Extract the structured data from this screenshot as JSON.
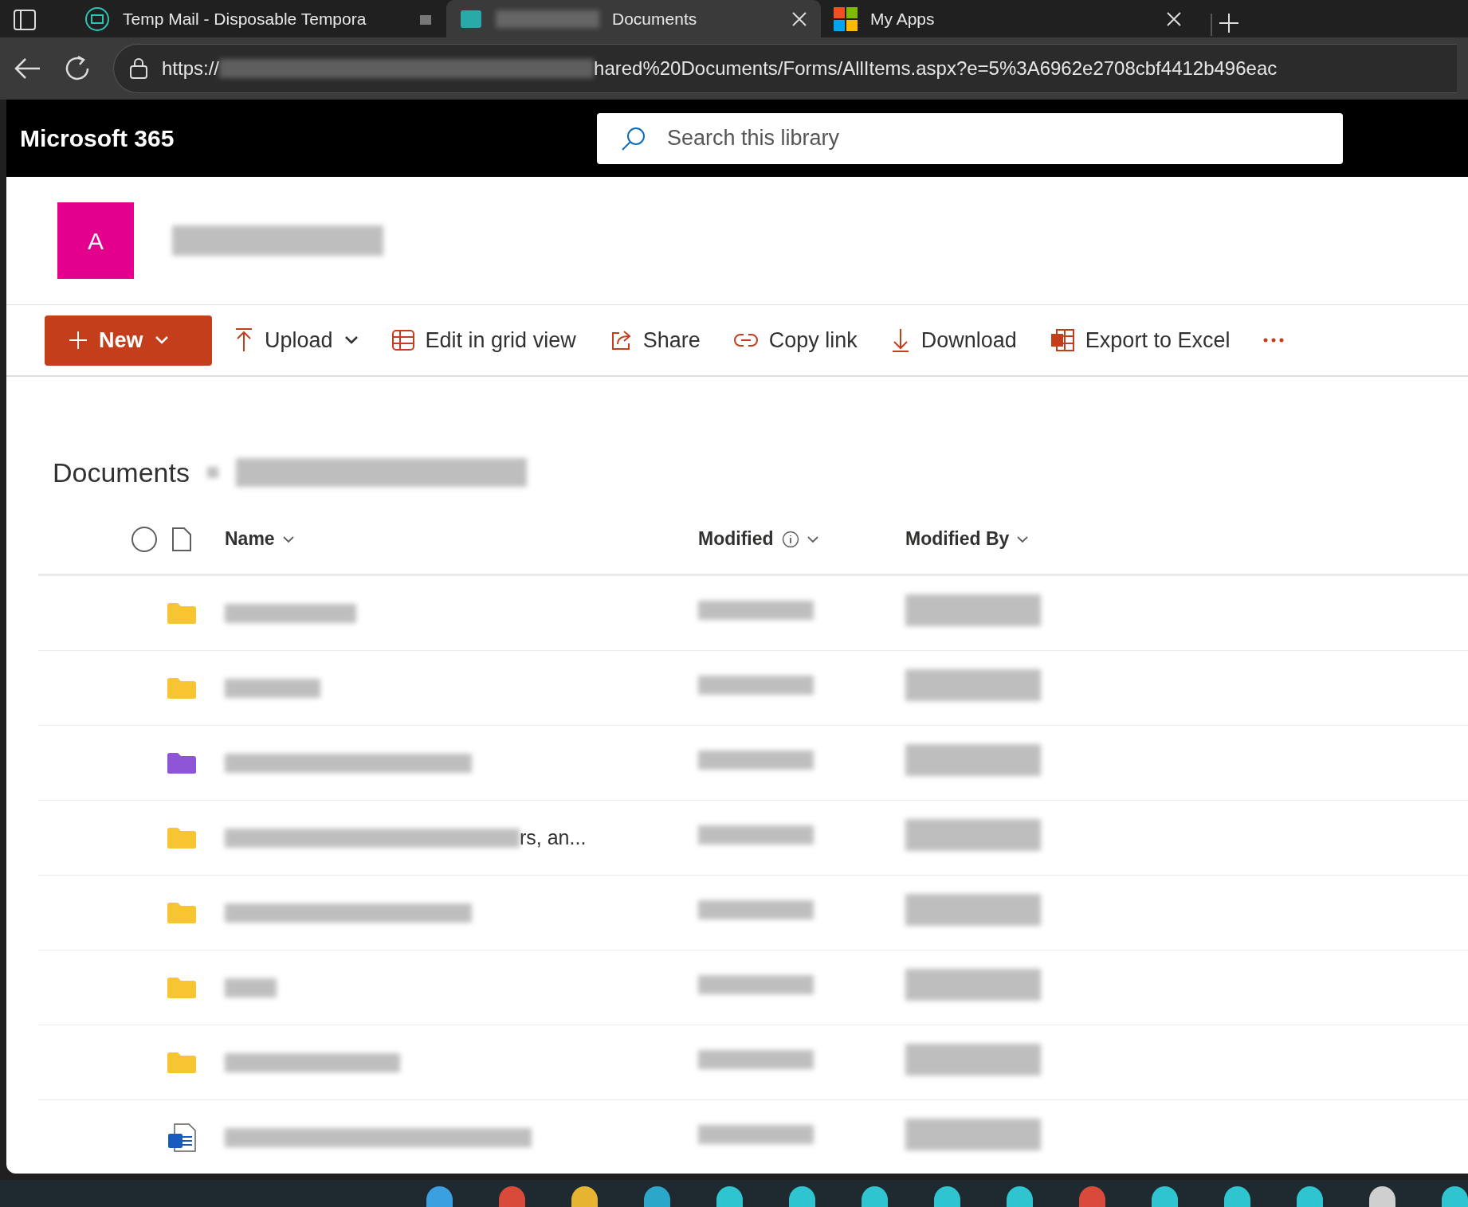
{
  "browser": {
    "tabs": [
      {
        "title": "Temp Mail - Disposable Tempora",
        "selected": false,
        "kind": "mail"
      },
      {
        "title": "Documents",
        "selected": true,
        "kind": "site"
      },
      {
        "title": "My Apps",
        "selected": false,
        "kind": "apps"
      }
    ],
    "address": {
      "prefix": "https://",
      "suffix": "hared%20Documents/Forms/AllItems.aspx?e=5%3A6962e2708cbf4412b496eac"
    }
  },
  "app": {
    "brand": "Microsoft 365",
    "search": {
      "placeholder": "Search this library"
    }
  },
  "site": {
    "initial": "A"
  },
  "commands": [
    {
      "label": "New",
      "kind": "new"
    },
    {
      "label": "Upload",
      "kind": "upload"
    },
    {
      "label": "Edit in grid view",
      "kind": "grid"
    },
    {
      "label": "Share",
      "kind": "share"
    },
    {
      "label": "Copy link",
      "kind": "link"
    },
    {
      "label": "Download",
      "kind": "download"
    },
    {
      "label": "Export to Excel",
      "kind": "excel"
    },
    {
      "kind": "more"
    }
  ],
  "breadcrumb": {
    "current": "Documents"
  },
  "select_all": {
    "checked": false
  },
  "columns": [
    {
      "label": "Name",
      "info": false
    },
    {
      "label": "Modified",
      "info": true
    },
    {
      "label": "Modified By",
      "info": false
    }
  ],
  "rows": [
    {
      "kind": "folder",
      "color": "#f7c531"
    },
    {
      "kind": "folder",
      "color": "#f7c531"
    },
    {
      "kind": "folder",
      "color": "#8e55d6"
    },
    {
      "kind": "folder",
      "color": "#f7c531",
      "name_visible": "rs, an..."
    },
    {
      "kind": "folder",
      "color": "#f7c531"
    },
    {
      "kind": "folder",
      "color": "#f7c531"
    },
    {
      "kind": "folder",
      "color": "#f7c531"
    },
    {
      "kind": "word"
    }
  ]
}
